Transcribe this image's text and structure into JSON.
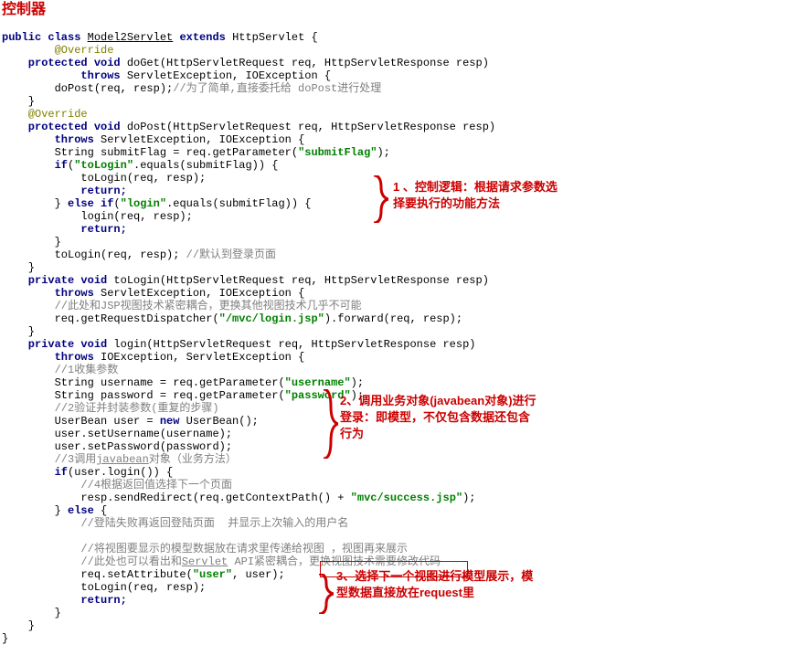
{
  "title": "控制器",
  "lines": {
    "l01a": "public class ",
    "l01b": "Model2Servlet",
    "l01c": " extends ",
    "l01d": "HttpServlet {",
    "l02": "        @Override",
    "l03a": "    protected void ",
    "l03b": "doGet(HttpServletRequest req, HttpServletResponse resp)",
    "l04a": "            throws ",
    "l04b": "ServletException, IOException {",
    "l05a": "        doPost(req, resp);",
    "l05b": "//为了简单,直接委托给 doPost进行处理",
    "l06": "    }",
    "l07": "    @Override",
    "l08a": "    protected void ",
    "l08b": "doPost(HttpServletRequest req, HttpServletResponse resp)",
    "l09a": "        throws ",
    "l09b": "ServletException, IOException {",
    "l10a": "        String submitFlag = req.getParameter(",
    "l10b": "\"submitFlag\"",
    "l10c": ");",
    "l11a": "        if",
    "l11b": "(",
    "l11c": "\"toLogin\"",
    "l11d": ".equals(submitFlag)) {",
    "l12": "            toLogin(req, resp);",
    "l13": "            return;",
    "l14a": "        } ",
    "l14b": "else if",
    "l14c": "(",
    "l14d": "\"login\"",
    "l14e": ".equals(submitFlag)) {",
    "l15": "            login(req, resp);",
    "l16": "            return;",
    "l17": "        }",
    "l18a": "        toLogin(req, resp); ",
    "l18b": "//默认到登录页面",
    "l19": "    }",
    "l20a": "    private void ",
    "l20b": "toLogin(HttpServletRequest req, HttpServletResponse resp)",
    "l21a": "        throws ",
    "l21b": "ServletException, IOException {",
    "l22": "        //此处和JSP视图技术紧密耦合，更换其他视图技术几乎不可能",
    "l23a": "        req.getRequestDispatcher(",
    "l23b": "\"/mvc/login.jsp\"",
    "l23c": ").forward(req, resp);",
    "l24": "    }",
    "l25a": "    private void ",
    "l25b": "login(HttpServletRequest req, HttpServletResponse resp)",
    "l26a": "        throws ",
    "l26b": "IOException, ServletException {",
    "l27": "        //1收集参数",
    "l28a": "        String username = req.getParameter(",
    "l28b": "\"username\"",
    "l28c": ");",
    "l29a": "        String password = req.getParameter(",
    "l29b": "\"password\"",
    "l29c": ");",
    "l30": "        //2验证并封装参数(重复的步骤)",
    "l31a": "        UserBean user = ",
    "l31b": "new ",
    "l31c": "UserBean();",
    "l32": "        user.setUsername(username);",
    "l33": "        user.setPassword(password);",
    "l34a": "        //3调用",
    "l34b": "javabean",
    "l34c": "对象（业务方法）",
    "l35a": "        if",
    "l35b": "(user.login()) {",
    "l36": "            //4根据返回值选择下一个页面",
    "l37a": "            resp.sendRedirect(req.getContextPath() + ",
    "l37b": "\"mvc/success.jsp\"",
    "l37c": ");",
    "l38a": "        } ",
    "l38b": "else ",
    "l38c": "{",
    "l39": "            //登陆失败再返回登陆页面  并显示上次输入的用户名",
    "l40": "",
    "l41": "            //将视图要显示的模型数据放在请求里传递给视图 ，视图再来展示",
    "l42a": "            //此处也可以看出和",
    "l42b": "Servlet",
    "l42c": " API紧密耦合，更换视图技术需要修改代码",
    "l43a": "            req.setAttribute(",
    "l43b": "\"user\"",
    "l43c": ", user);",
    "l44": "            toLogin(req, resp);",
    "l45": "            return;",
    "l46": "        }",
    "l47": "    }",
    "l48": "}"
  },
  "annotations": {
    "a1": "1 、控制逻辑：根据请求参数选择要执行的功能方法",
    "a2": "2、调用业务对象(javabean对象)进行登录：即模型，不仅包含数据还包含行为",
    "a3": "3、选择下一个视图进行模型展示，模型数据直接放在request里"
  }
}
